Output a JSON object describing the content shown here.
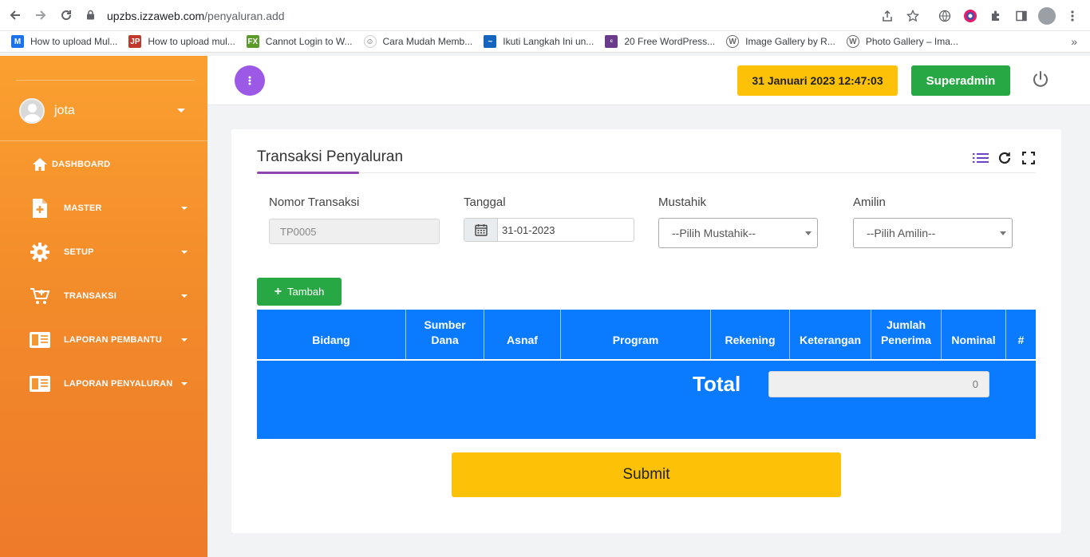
{
  "browser": {
    "url_host": "upzbs.izzaweb.com",
    "url_path": "/penyaluran.add",
    "bookmarks": [
      {
        "label": "How to upload Mul...",
        "icon": "gmail-icon",
        "color": "#1a73e8"
      },
      {
        "label": "How to upload mul...",
        "icon": "jp-icon",
        "color": "#c0392b"
      },
      {
        "label": "Cannot Login to W...",
        "icon": "fx-icon",
        "color": "#5b9b2a"
      },
      {
        "label": "Cara Mudah Memb...",
        "icon": "person-icon",
        "color": "#555555"
      },
      {
        "label": "Ikuti Langkah Ini un...",
        "icon": "wave-icon",
        "color": "#1565c0"
      },
      {
        "label": "20 Free WordPress...",
        "icon": "colorlib-icon",
        "color": "#6a3a8c"
      },
      {
        "label": "Image Gallery by R...",
        "icon": "wordpress-icon",
        "color": "#666666"
      },
      {
        "label": "Photo Gallery – Ima...",
        "icon": "wordpress-icon",
        "color": "#666666"
      }
    ],
    "more": "»"
  },
  "sidebar": {
    "user": "jota",
    "items": [
      {
        "label": "DASHBOARD",
        "icon": "home-icon",
        "caret": false
      },
      {
        "label": "MASTER",
        "icon": "file-plus-icon",
        "caret": true
      },
      {
        "label": "SETUP",
        "icon": "gear-icon",
        "caret": true
      },
      {
        "label": "TRANSAKSI",
        "icon": "cart-plus-icon",
        "caret": true
      },
      {
        "label": "LAPORAN PEMBANTU",
        "icon": "report-icon",
        "caret": true
      },
      {
        "label": "LAPORAN PENYALURAN",
        "icon": "report-icon",
        "caret": true
      }
    ]
  },
  "topbar": {
    "datetime": "31 Januari 2023 12:47:03",
    "role": "Superadmin"
  },
  "card": {
    "title": "Transaksi Penyaluran",
    "fields": {
      "nomor_label": "Nomor Transaksi",
      "nomor_value": "TP0005",
      "tanggal_label": "Tanggal",
      "tanggal_value": "31-01-2023",
      "mustahik_label": "Mustahik",
      "mustahik_value": "--Pilih Mustahik--",
      "amilin_label": "Amilin",
      "amilin_value": "--Pilih Amilin--"
    },
    "add_button": "Tambah",
    "table": {
      "headers": [
        "Bidang",
        "Sumber\nDana",
        "Asnaf",
        "Program",
        "Rekening",
        "Keterangan",
        "Jumlah\nPenerima",
        "Nominal",
        "#"
      ],
      "total_label": "Total",
      "total_value": "0"
    },
    "submit": "Submit"
  },
  "colors": {
    "sidebar_top": "#fba030",
    "sidebar_bottom": "#ee7a2a",
    "accent_purple": "#9b59e6",
    "table_blue": "#0a7bff",
    "yellow": "#fdc107",
    "green": "#28a745"
  }
}
